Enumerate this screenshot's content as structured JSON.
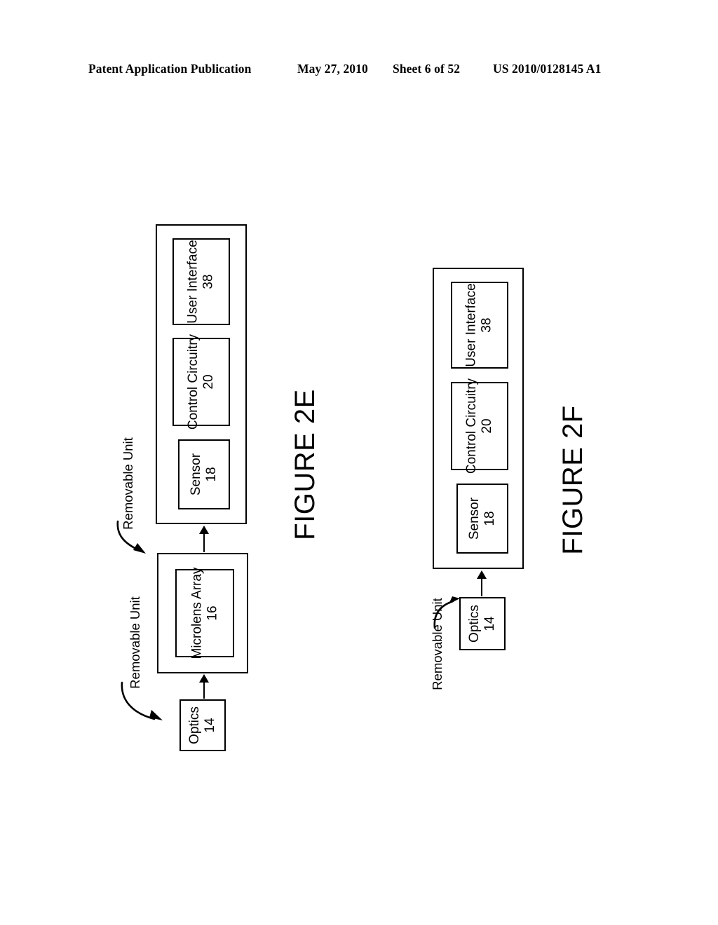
{
  "header": {
    "publication": "Patent Application Publication",
    "date": "May 27, 2010",
    "sheet": "Sheet 6 of 52",
    "patent_number": "US 2010/0128145 A1"
  },
  "figures": [
    {
      "caption": "FIGURE 2E",
      "callouts": [
        {
          "label": "Removable Unit"
        },
        {
          "label": "Removable Unit"
        }
      ],
      "body_unit": {
        "name": "camera-body-unit",
        "blocks": [
          {
            "title": "User Interface",
            "ref": "38"
          },
          {
            "title": "Control Circuitry",
            "ref": "20"
          },
          {
            "title": "Sensor",
            "ref": "18"
          }
        ]
      },
      "middle_unit": {
        "name": "microlens-removable-unit",
        "blocks": [
          {
            "title": "Microlens Array",
            "ref": "16"
          }
        ]
      },
      "optics_unit": {
        "name": "optics-unit",
        "blocks": [
          {
            "title": "Optics",
            "ref": "14"
          }
        ]
      }
    },
    {
      "caption": "FIGURE 2F",
      "callouts": [
        {
          "label": "Removable Unit"
        }
      ],
      "body_unit": {
        "name": "camera-body-unit",
        "blocks": [
          {
            "title": "User Interface",
            "ref": "38"
          },
          {
            "title": "Control Circuitry",
            "ref": "20"
          },
          {
            "title": "Sensor",
            "ref": "18"
          }
        ]
      },
      "optics_unit": {
        "name": "optics-unit",
        "blocks": [
          {
            "title": "Optics",
            "ref": "14"
          }
        ]
      }
    }
  ],
  "colors": {
    "ink": "#000000",
    "paper": "#ffffff"
  }
}
